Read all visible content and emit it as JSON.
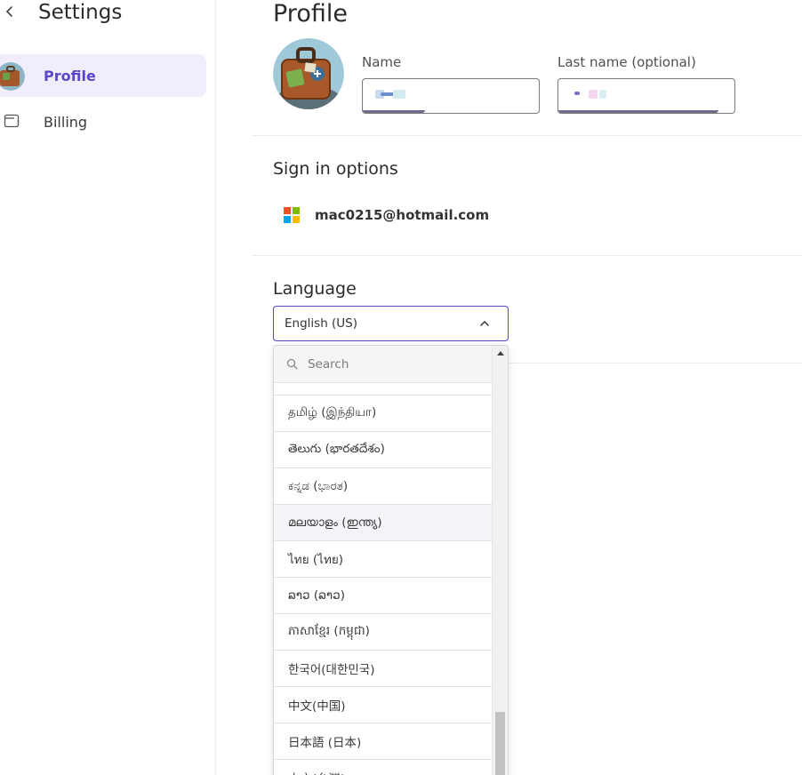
{
  "sidebar": {
    "title": "Settings",
    "items": [
      {
        "label": "Profile",
        "active": true
      },
      {
        "label": "Billing",
        "active": false
      }
    ]
  },
  "main": {
    "title": "Profile",
    "name_label": "Name",
    "last_name_label": "Last name (optional)",
    "signin": {
      "title": "Sign in options",
      "email": "mac0215@hotmail.com",
      "provider_icon": "microsoft-logo-icon"
    },
    "language": {
      "title": "Language",
      "selected": "English (US)",
      "search_placeholder": "Search",
      "options": [
        "தமிழ் (இந்தியா)",
        "తెలుగు (భారతదేశం)",
        "ಕನ್ನಡ (ಭಾರತ)",
        "മലയാളം (ഇന്ത്യ)",
        "ไทย (ไทย)",
        "ລາວ (ລາວ)",
        "ភាសាខ្មែរ (កម្ពុជា)",
        "한국어(대한민국)",
        "中文(中国)",
        "日本語 (日本)",
        "中文(台灣)"
      ]
    }
  },
  "colors": {
    "accent": "#5b47c9",
    "active_bg": "#f1eefc",
    "ms_red": "#f25022",
    "ms_green": "#7fba00",
    "ms_blue": "#00a4ef",
    "ms_yellow": "#ffb900"
  }
}
